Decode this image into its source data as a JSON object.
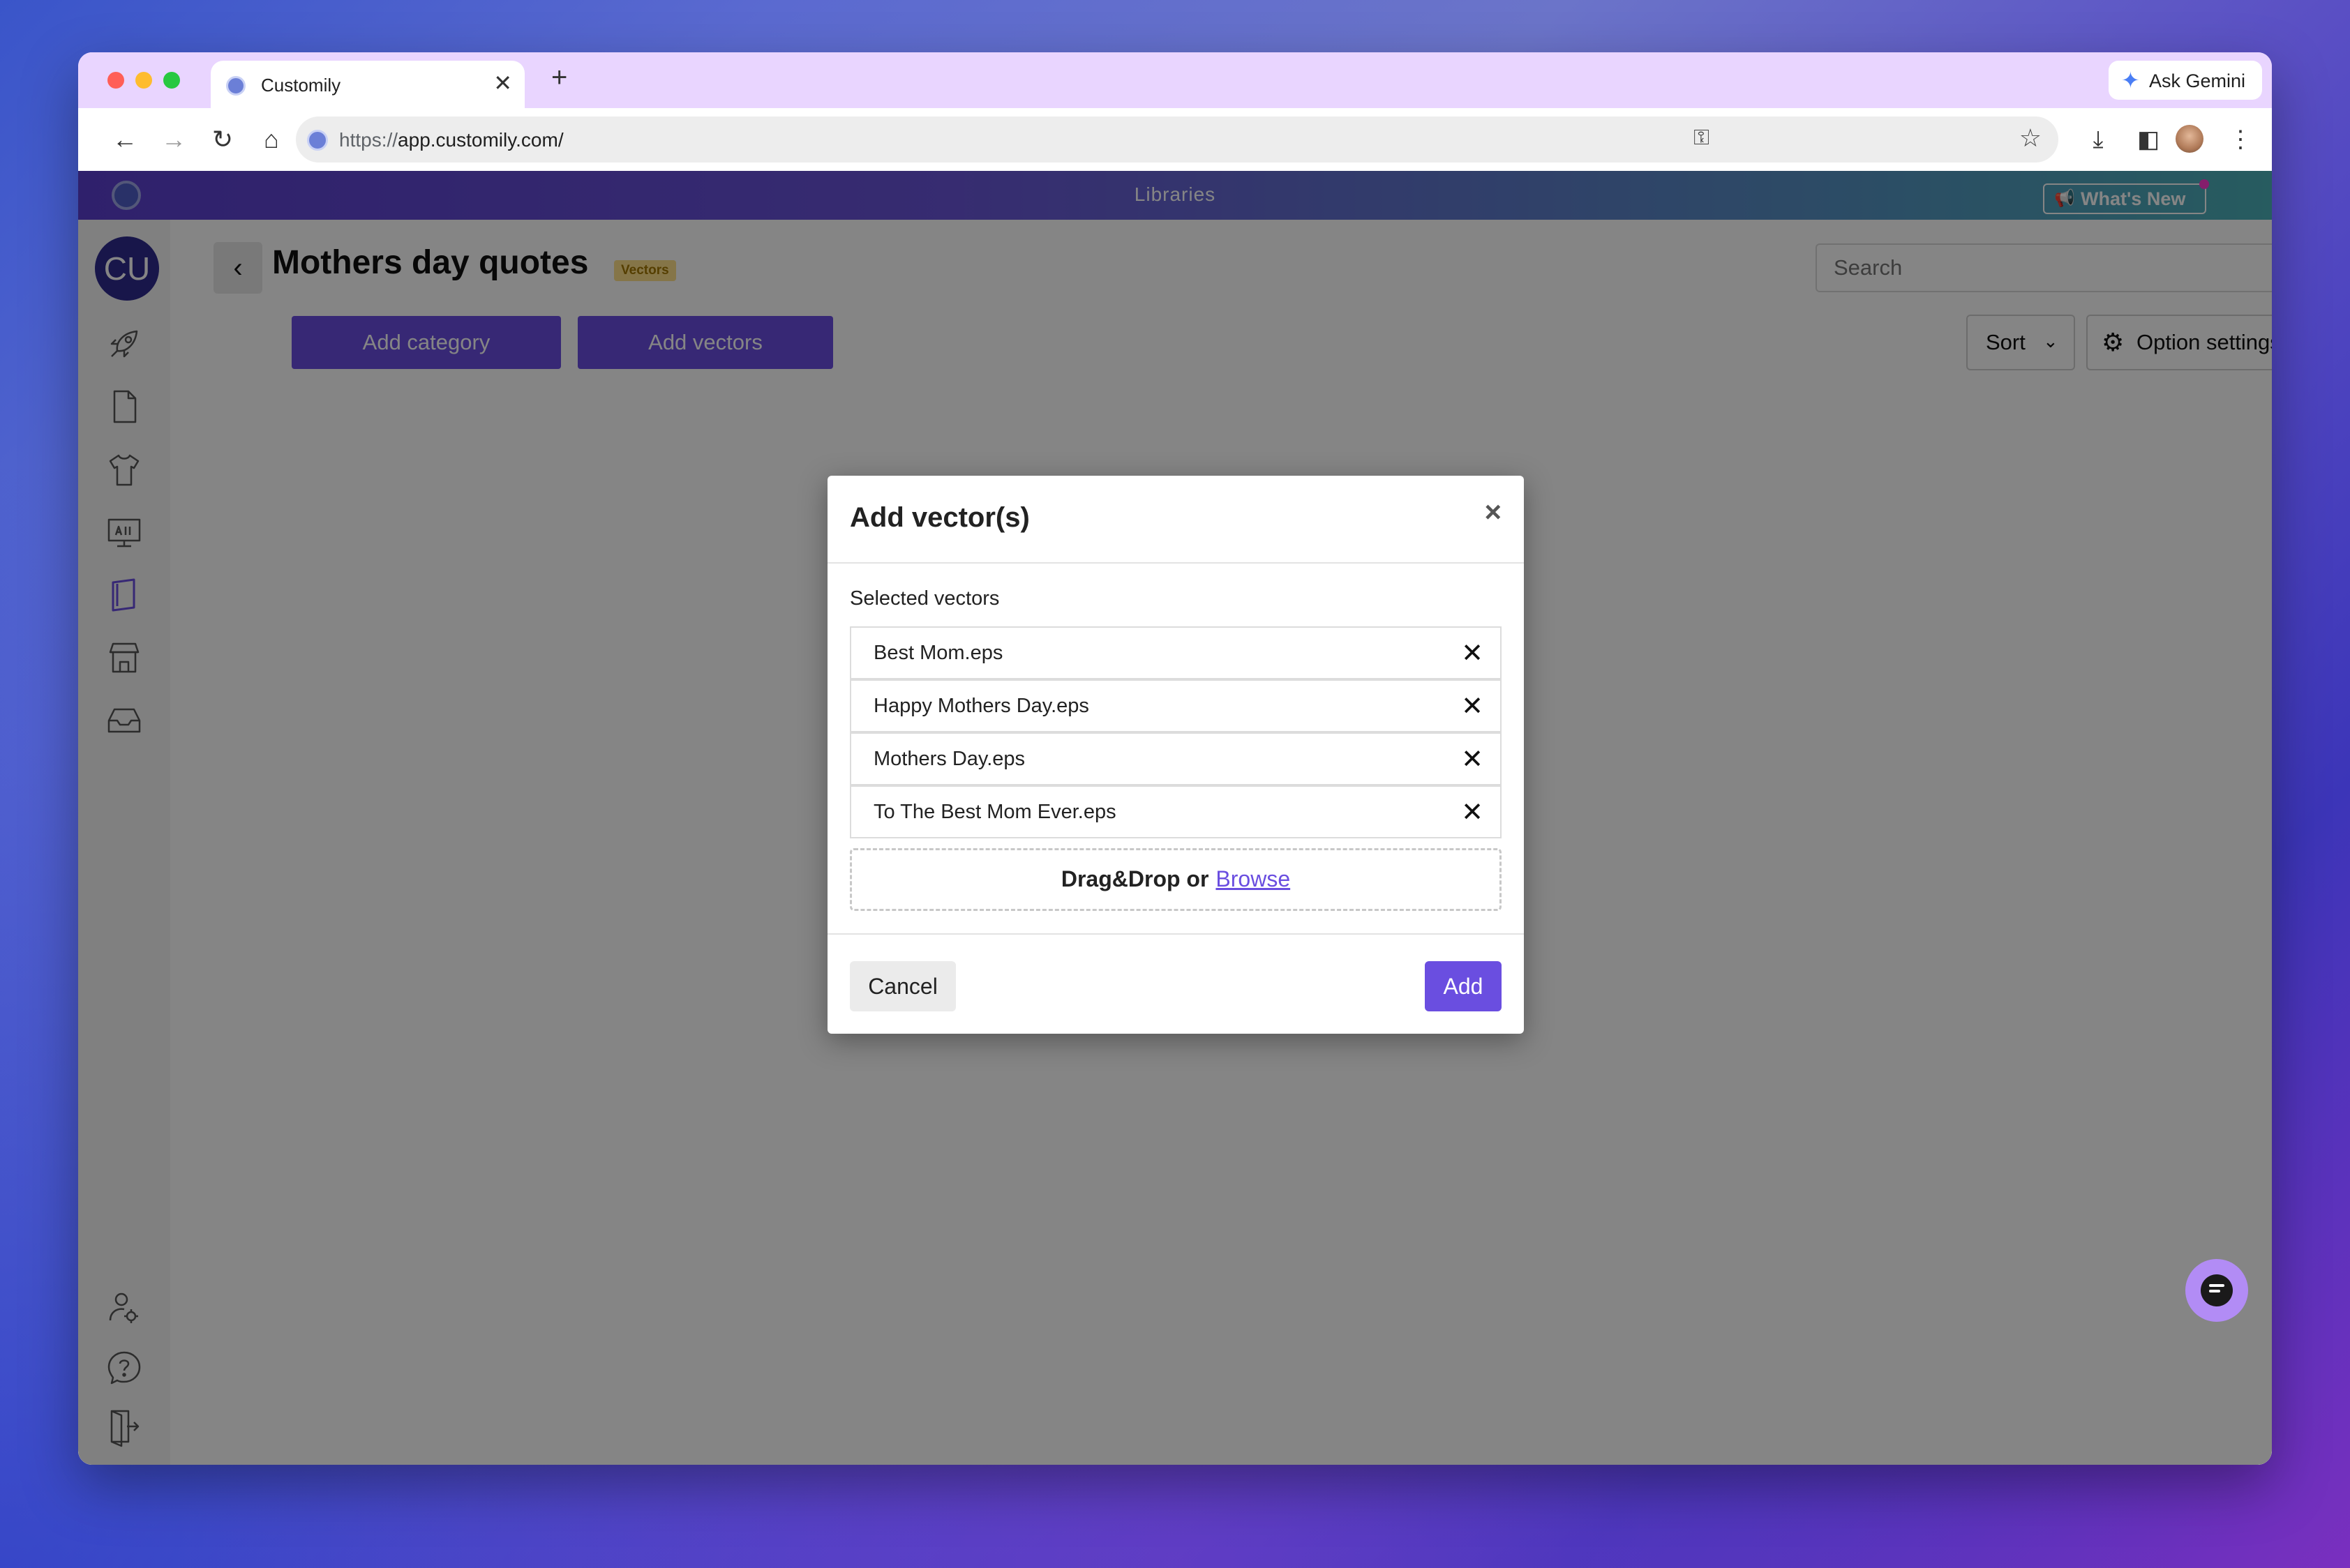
{
  "browser": {
    "tab_title": "Customily",
    "tab_close": "✕",
    "new_tab": "+",
    "gemini_label": "Ask Gemini",
    "url_scheme": "https://",
    "url_host": "app.customily.com/"
  },
  "app": {
    "section_title": "Libraries",
    "whats_new": "What's New",
    "user_initials": "CU"
  },
  "sidebar": {
    "items": [
      {
        "icon": "rocket-icon"
      },
      {
        "icon": "document-icon"
      },
      {
        "icon": "tshirt-icon"
      },
      {
        "icon": "monitor-icon"
      },
      {
        "icon": "library-book-icon",
        "active": true
      },
      {
        "icon": "store-icon"
      },
      {
        "icon": "inbox-icon"
      },
      {
        "icon": "user-settings-icon"
      },
      {
        "icon": "help-icon"
      },
      {
        "icon": "logout-icon"
      }
    ]
  },
  "library": {
    "title": "Mothers day quotes",
    "badge": "Vectors",
    "search_placeholder": "Search",
    "add_category": "Add category",
    "add_vectors": "Add vectors",
    "sort": "Sort",
    "option_settings": "Option settings"
  },
  "modal": {
    "title": "Add vector(s)",
    "close": "×",
    "selected_label": "Selected vectors",
    "files": [
      "Best Mom.eps",
      "Happy Mothers Day.eps",
      "Mothers Day.eps",
      "To The Best Mom Ever.eps"
    ],
    "dropzone_text": "Drag&Drop or",
    "browse": "Browse",
    "cancel": "Cancel",
    "add": "Add"
  },
  "colors": {
    "accent": "#6a4ee0",
    "tabstrip": "#e9d5ff",
    "badge_bg": "#ffe08a"
  }
}
